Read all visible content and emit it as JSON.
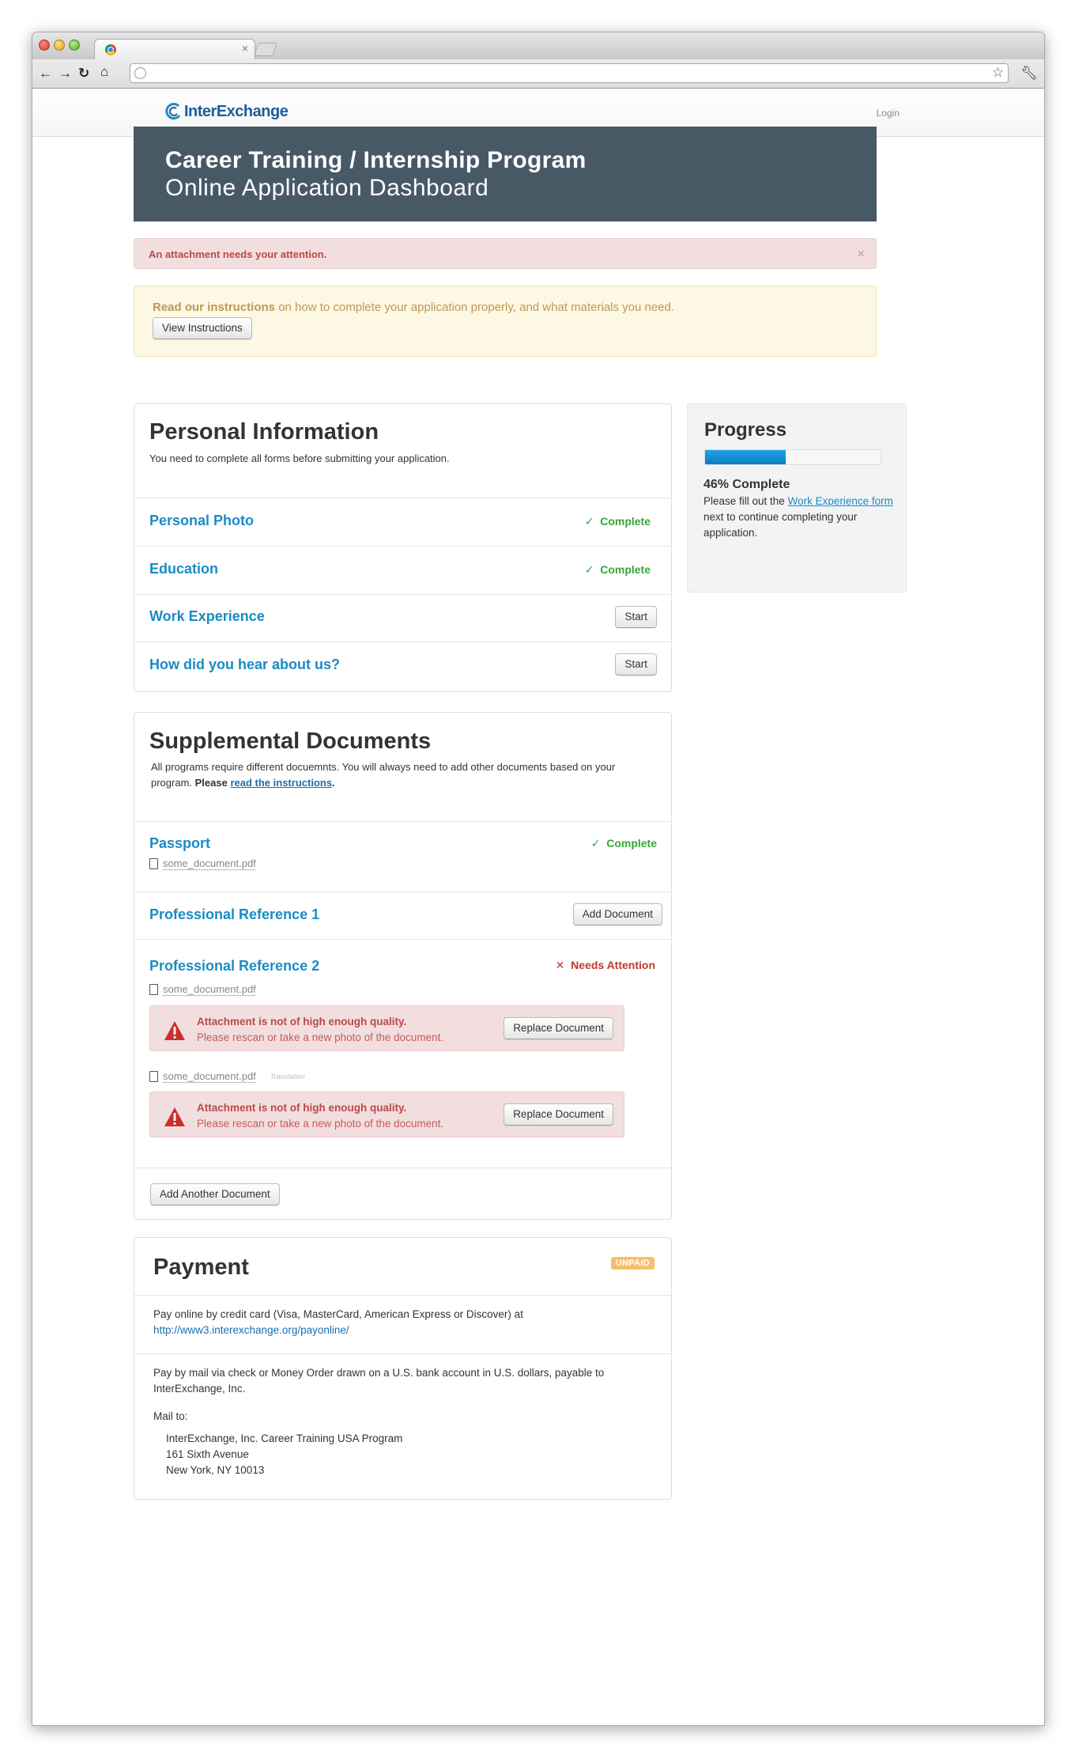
{
  "browser": {
    "tab_close": "×",
    "icons": [
      "back-icon",
      "forward-icon",
      "reload-icon",
      "home-icon",
      "globe-icon",
      "star-icon",
      "wrench-icon"
    ]
  },
  "site": {
    "logo_text": "InterExchange",
    "login": "Login"
  },
  "banner": {
    "title": "Career Training / Internship Program",
    "subtitle": "Online Application Dashboard"
  },
  "alert": {
    "text": "An attachment needs your attention.",
    "close": "×"
  },
  "instructions": {
    "lead": "Read our instructions",
    "rest": " on how to complete your application properly, and what materials you need.",
    "button": "View Instructions"
  },
  "personal": {
    "title": "Personal Information",
    "subtitle": "You need to complete all forms before submitting your application.",
    "rows": [
      {
        "label": "Personal Photo",
        "status": "Complete"
      },
      {
        "label": "Education",
        "status": "Complete"
      },
      {
        "label": "Work Experience",
        "action": "Start"
      },
      {
        "label": "How did you hear about us?",
        "action": "Start"
      }
    ]
  },
  "progress": {
    "title": "Progress",
    "percent": 46,
    "percent_text": "46% Complete",
    "msg_before": "Please fill out the ",
    "msg_link": "Work Experience form",
    "msg_after": " next to continue completing your application."
  },
  "supplemental": {
    "title": "Supplemental Documents",
    "sub_text": "All programs require different docuemnts. You will always need to add other documents based on your program. ",
    "sub_bold": "Please",
    "sub_link": "read the instructions",
    "sub_end": ".",
    "passport": {
      "label": "Passport",
      "status": "Complete",
      "file": "some_document.pdf"
    },
    "ref1": {
      "label": "Professional Reference 1",
      "button": "Add Document"
    },
    "ref2": {
      "label": "Professional Reference 2",
      "status": "Needs Attention",
      "files": [
        {
          "name": "some_document.pdf",
          "note": ""
        },
        {
          "name": "some_document.pdf",
          "note": "Translation"
        }
      ],
      "warning_title": "Attachment is not of high enough quality.",
      "warning_text": "Please rescan or take a new photo of the document.",
      "replace_button": "Replace Document"
    },
    "add_another": "Add Another Document"
  },
  "payment": {
    "title": "Payment",
    "badge": "UNPAID",
    "online_text": "Pay online by credit card (Visa, MasterCard, American Express or Discover) at",
    "online_link": "http://www3.interexchange.org/payonline/",
    "mail_text": "Pay by mail via check or Money Order drawn on a U.S. bank account in U.S. dollars, payable to InterExchange, Inc.",
    "mail_to": "Mail to:",
    "address": [
      "InterExchange, Inc. Career Training USA Program",
      "161 Sixth Avenue",
      "New York, NY 10013"
    ]
  },
  "colors": {
    "banner": "#485966",
    "link": "#1a8bc6",
    "success": "#3aa53a",
    "danger": "#b94a48",
    "warning_bg": "#fcf8e3",
    "progress": "#0d7cc2",
    "unpaid": "#f7bf6c"
  }
}
